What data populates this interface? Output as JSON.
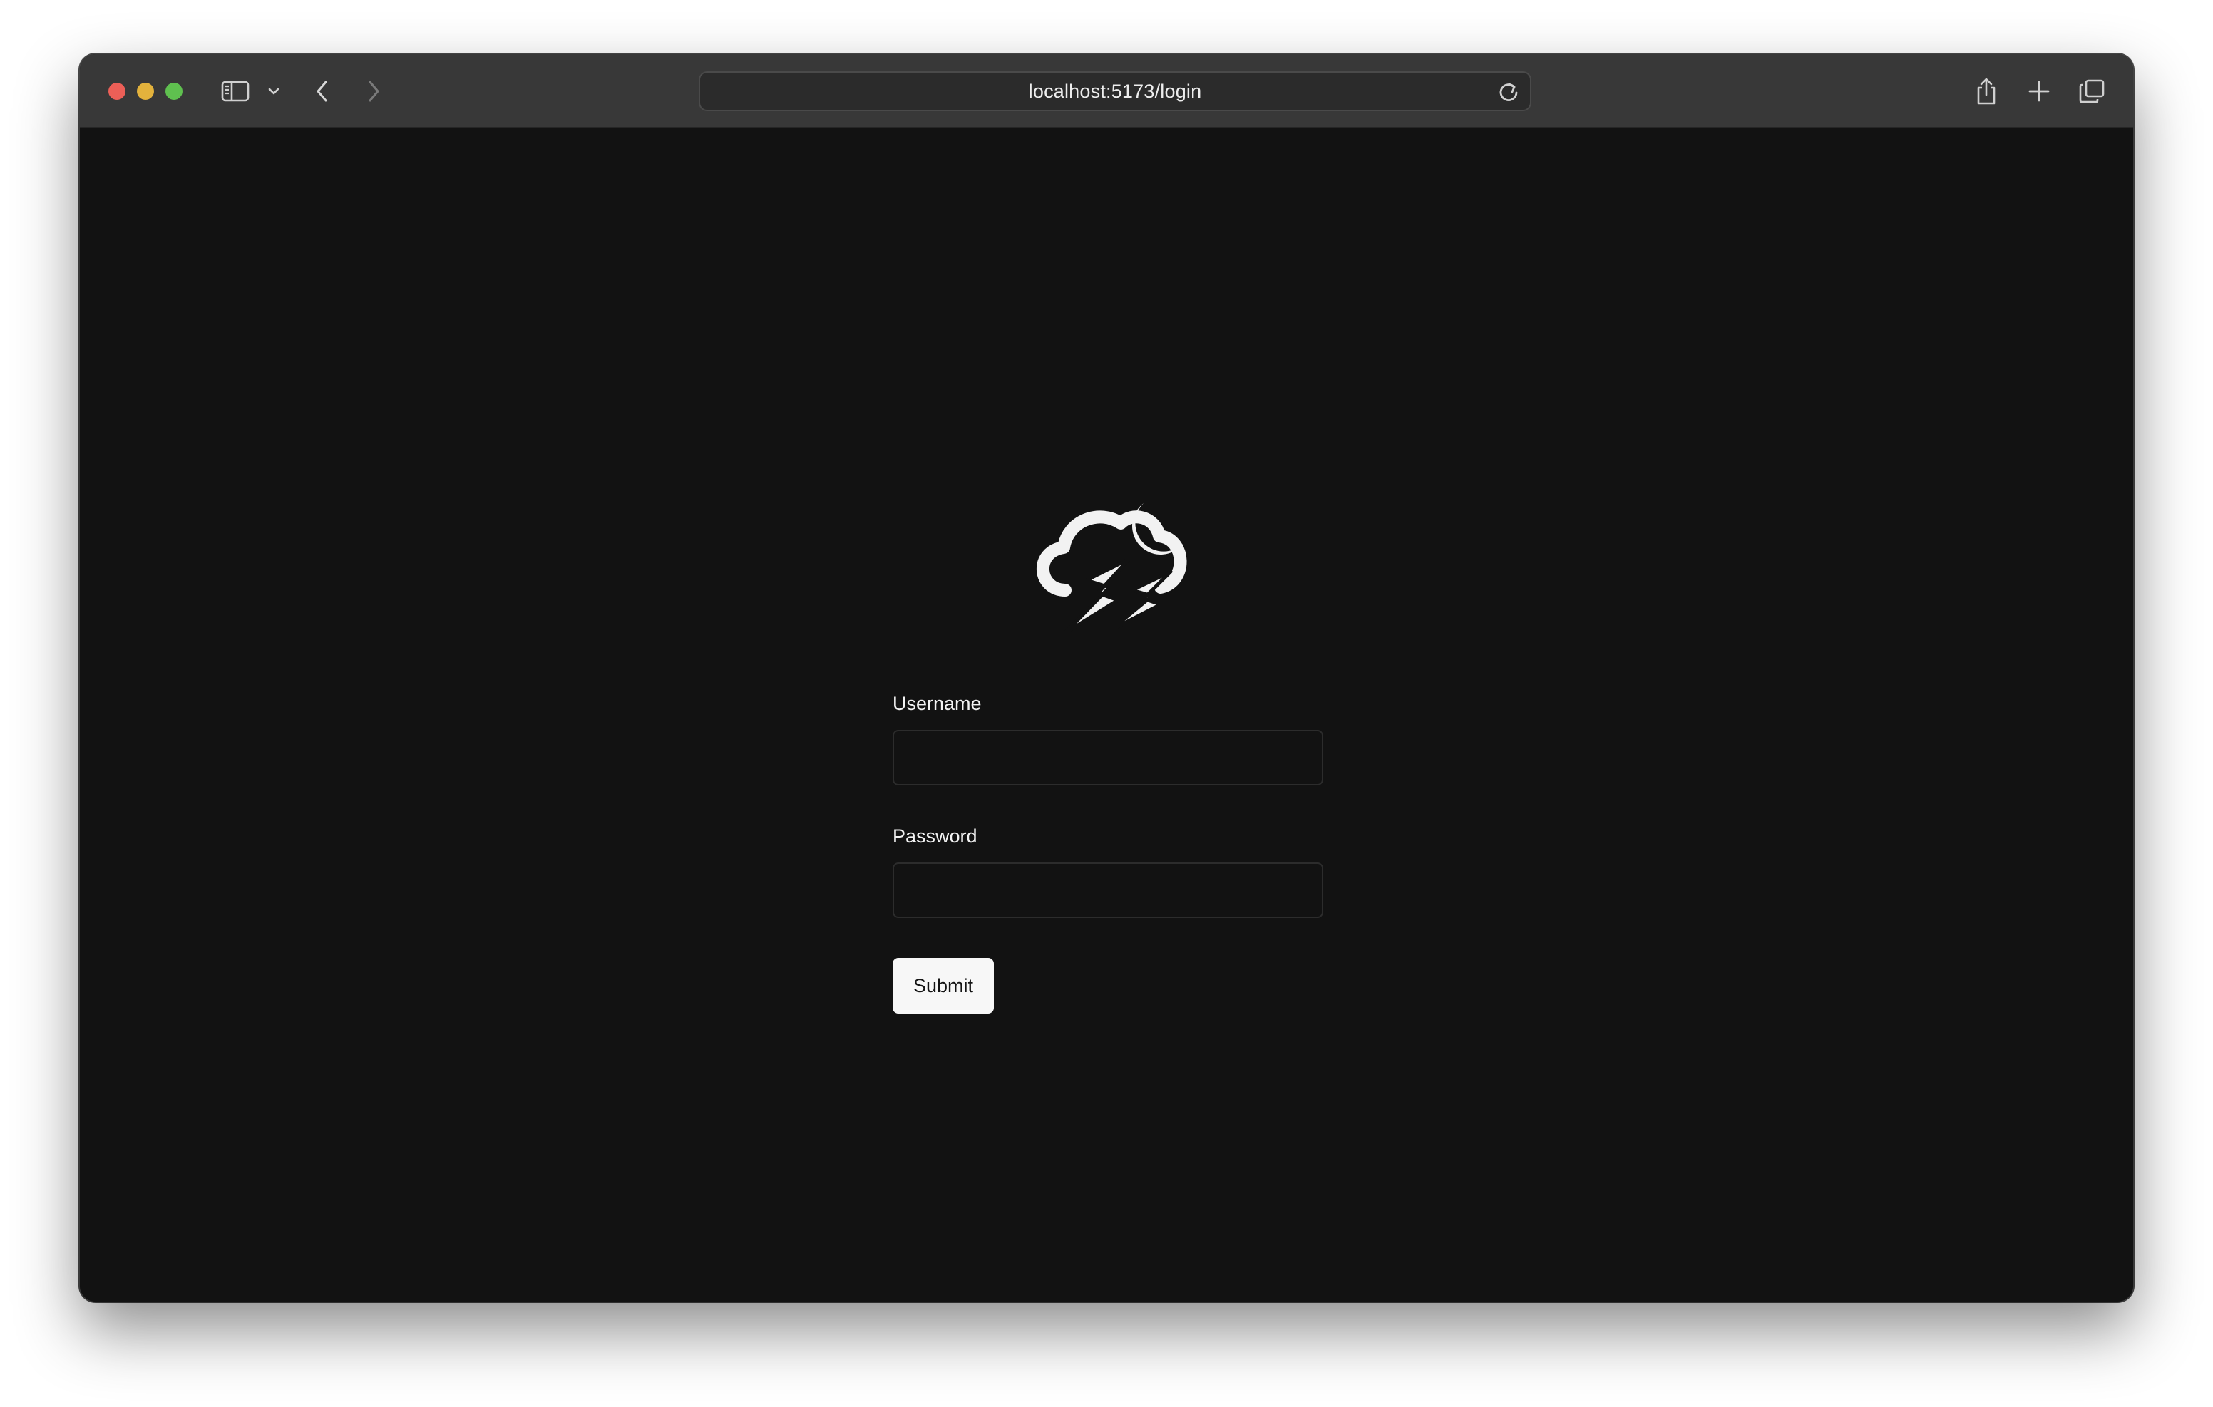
{
  "browser": {
    "url": "localhost:5173/login",
    "icons": {
      "sidebar": "sidebar-icon",
      "sidebar_menu": "chevron-down-icon",
      "back": "chevron-left-icon",
      "forward": "chevron-right-icon",
      "reload": "reload-icon",
      "share": "share-icon",
      "new_tab": "plus-icon",
      "tabs": "tab-overview-icon"
    }
  },
  "login": {
    "logo_icon": "thunderstorm-night-icon",
    "username_label": "Username",
    "username_value": "",
    "password_label": "Password",
    "password_value": "",
    "submit_label": "Submit"
  },
  "colors": {
    "page_background": "#121212",
    "toolbar_background": "#383838",
    "button_background": "#f7f7f7",
    "text": "#f2f2f2"
  }
}
